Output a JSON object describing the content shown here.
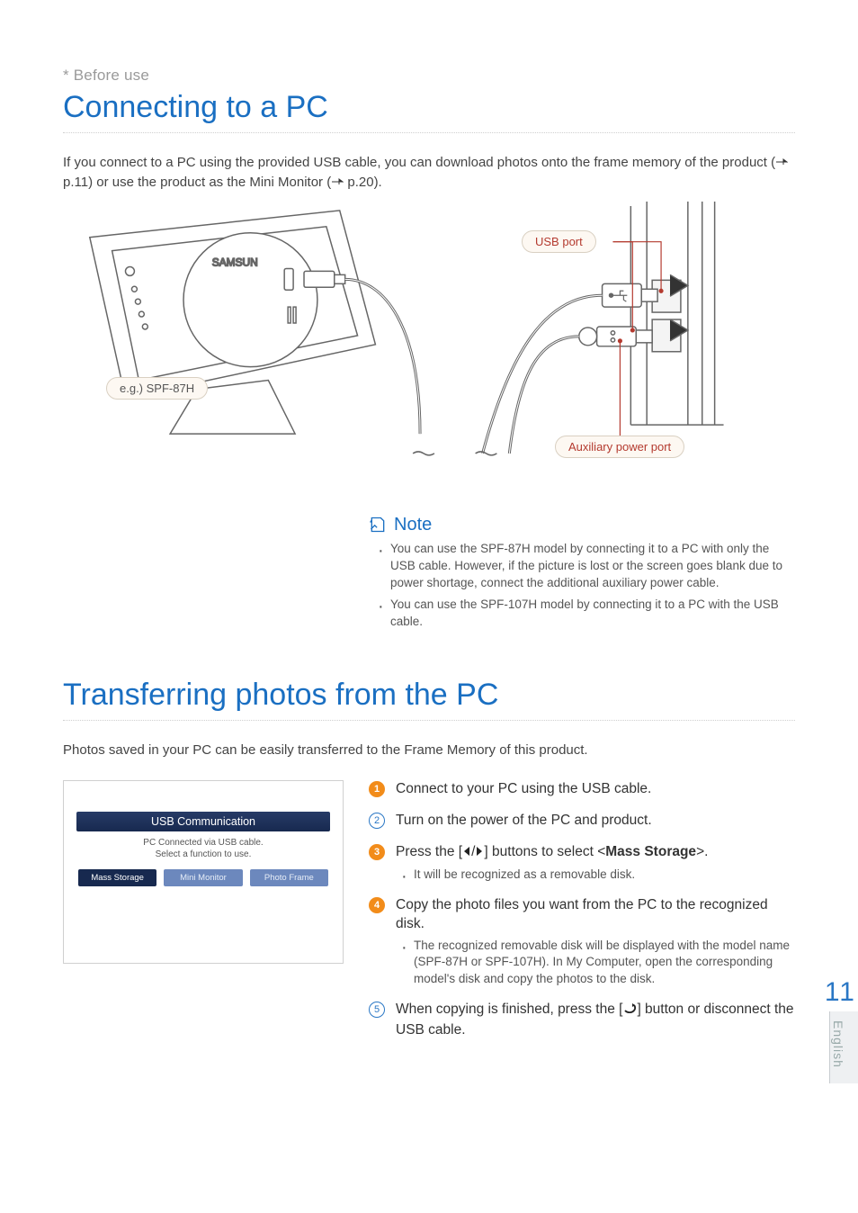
{
  "pretitle_prefix": "*",
  "pretitle": "Before use",
  "section1": {
    "title": "Connecting to a PC",
    "intro_a": "If you connect to a PC using the provided USB cable, you can download photos onto the frame memory of the product (",
    "intro_b": " p.11) or use the product as the Mini Monitor (",
    "intro_c": " p.20)."
  },
  "diagram_labels": {
    "usb": "USB port",
    "aux": "Auxiliary power port",
    "eg": "e.g.) SPF-87H",
    "brand": "SAMSUN"
  },
  "note": {
    "heading": "Note",
    "items": [
      "You can use the SPF-87H model by connecting it to a PC with only the USB cable. However, if the picture is lost or the screen goes blank due to power shortage, connect the additional auxiliary power cable.",
      "You can use the SPF-107H model by connecting it to a PC with the USB cable."
    ]
  },
  "section2": {
    "title": "Transferring photos from the PC",
    "intro": "Photos saved in your PC can be easily transferred to the Frame Memory of this product."
  },
  "screenshot": {
    "bar": "USB Communication",
    "msg1": "PC Connected via USB cable.",
    "msg2": "Select a function to use.",
    "buttons": [
      "Mass Storage",
      "Mini Monitor",
      "Photo Frame"
    ]
  },
  "steps": [
    {
      "num": "1",
      "title": "Connect to your PC using the USB cable."
    },
    {
      "num": "2",
      "title": "Turn on the power of the PC and product."
    },
    {
      "num": "3",
      "title_a": "Press the [",
      "title_b": "] buttons to select <",
      "title_strong": "Mass Storage",
      "title_c": ">.",
      "sub": "It will be recognized as a removable disk."
    },
    {
      "num": "4",
      "title": "Copy the photo files you want from the PC to the recognized disk.",
      "sub": "The recognized removable disk will be displayed with the model name (SPF-87H or SPF-107H). In My Computer, open the corresponding model's disk and copy the photos to the disk."
    },
    {
      "num": "5",
      "title_a": "When copying is finished, press the [",
      "title_b": "] button or disconnect the USB cable."
    }
  ],
  "page_number": "11",
  "language_tab": "English"
}
